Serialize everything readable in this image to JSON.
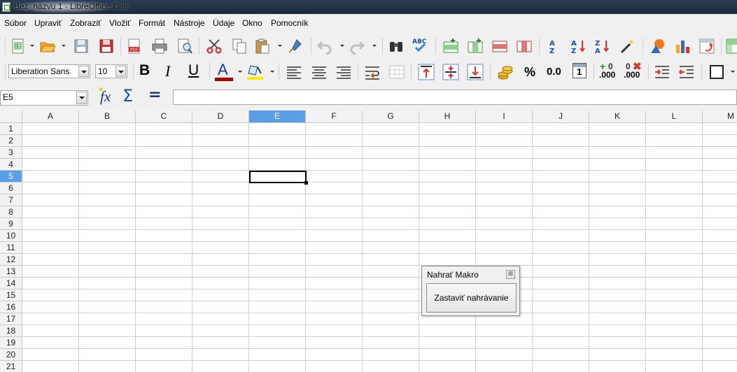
{
  "window": {
    "title": "Bez_názvu 1 - LibreOffice Calc"
  },
  "menu": [
    "Súbor",
    "Upraviť",
    "Zobraziť",
    "Vložiť",
    "Formát",
    "Nástroje",
    "Údaje",
    "Okno",
    "Pomocník"
  ],
  "format_toolbar": {
    "font_name": "Liberation Sans",
    "font_size": "10",
    "bold": "B",
    "italic": "I",
    "underline": "U",
    "font_color_letter": "A",
    "percent": "%",
    "number_format": "0.0",
    "calendar_day": "1",
    "add_decimal": ".000",
    "remove_decimal": ".000"
  },
  "formula_bar": {
    "name_box": "E5",
    "function_wizard": "fx",
    "sum": "Σ",
    "equals": "=",
    "content": ""
  },
  "sheet": {
    "columns": [
      "A",
      "B",
      "C",
      "D",
      "E",
      "F",
      "G",
      "H",
      "I",
      "J",
      "K",
      "L",
      "M"
    ],
    "rows": [
      "1",
      "2",
      "3",
      "4",
      "5",
      "6",
      "7",
      "8",
      "9",
      "10",
      "11",
      "12",
      "13",
      "14",
      "15",
      "16",
      "17",
      "18",
      "19",
      "20",
      "21"
    ],
    "selected_column": "E",
    "selected_row": "5",
    "selected_cell": "E5"
  },
  "macro_dialog": {
    "title": "Nahrať Makro",
    "close": "⊠",
    "stop_button": "Zastaviť nahrávanie"
  },
  "colors": {
    "selection_header": "#5a9ee6",
    "toolbar_bg": "#f0f0f0"
  }
}
